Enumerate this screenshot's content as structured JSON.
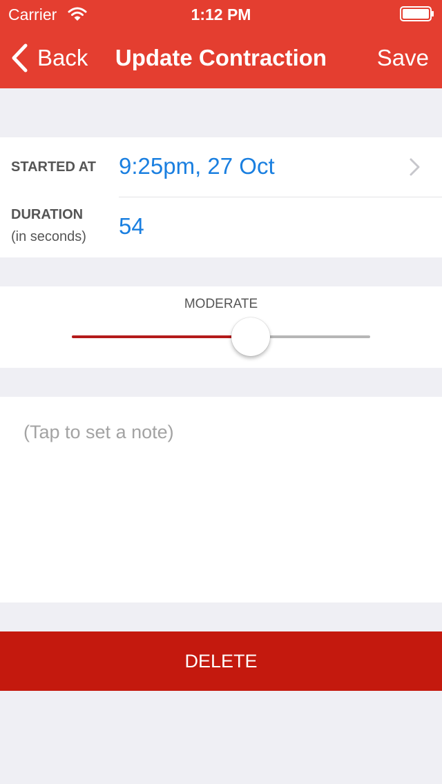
{
  "colors": {
    "header_background": "#e43e30",
    "header_text": "#ffffff",
    "page_background": "#efeff4",
    "value_blue": "#1a7fe0",
    "slider_fill": "#b41a1a",
    "slider_track": "#b6b6b6",
    "delete_background": "#c4190e"
  },
  "status_bar": {
    "carrier": "Carrier",
    "time": "1:12 PM",
    "icons": [
      "wifi-icon",
      "battery-icon"
    ]
  },
  "nav": {
    "back_label": "Back",
    "back_icon": "chevron-left-icon",
    "title": "Update Contraction",
    "save_label": "Save"
  },
  "started": {
    "label": "STARTED AT",
    "value": "9:25pm, 27 Oct",
    "icon": "chevron-right-icon"
  },
  "duration": {
    "label": "DURATION",
    "sublabel": "(in seconds)",
    "value": "54"
  },
  "intensity": {
    "label": "MODERATE",
    "slider_level": 0.6
  },
  "note": {
    "placeholder": "(Tap to set a note)"
  },
  "delete": {
    "label": "DELETE"
  }
}
